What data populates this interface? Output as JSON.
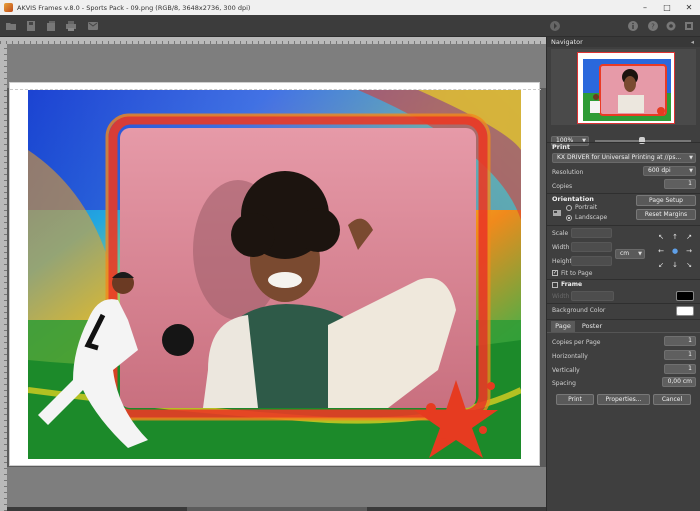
{
  "window": {
    "title": "AKVIS Frames v.8.0 - Sports Pack - 09.png (RGB/8, 3648x2736, 300 dpi)",
    "buttons": [
      "–",
      "□",
      "✕"
    ]
  },
  "toolbar": {
    "left_icons": [
      "open-icon",
      "save-icon",
      "batch-icon",
      "print-icon",
      "share-icon"
    ],
    "right_icons": [
      "run-icon",
      "info-icon",
      "help-icon",
      "settings-icon",
      "plugin-icon"
    ]
  },
  "navigator": {
    "title": "Navigator",
    "zoom": "100%",
    "zoom_slider_fraction": 0.5
  },
  "print": {
    "title": "Print",
    "printer": "KX DRIVER for Universal Printing at //ps...",
    "resolution_label": "Resolution",
    "resolution": "600 dpi",
    "copies_label": "Copies",
    "copies": "1"
  },
  "orientation": {
    "title": "Orientation",
    "portrait": "Portrait",
    "landscape": "Landscape",
    "selected": "Landscape",
    "page_setup": "Page Setup",
    "reset_margins": "Reset Margins"
  },
  "size": {
    "scale_label": "Scale",
    "width_label": "Width",
    "height_label": "Height",
    "scale": "",
    "width": "",
    "height": "",
    "unit": "cm",
    "fit_to_page_label": "Fit to Page",
    "fit_to_page": true,
    "arrows": [
      "↖",
      "↑",
      "↗",
      "←",
      "●",
      "→",
      "↙",
      "↓",
      "↘"
    ]
  },
  "frame": {
    "label": "Frame",
    "checked": false,
    "width_label": "Width",
    "width": "",
    "color": "#000000"
  },
  "background": {
    "label": "Background Color",
    "color": "#ffffff"
  },
  "tabs": [
    "Page",
    "Poster"
  ],
  "active_tab": "Page",
  "page": {
    "copies_per_page_label": "Copies per Page",
    "copies_per_page": "1",
    "horizontally_label": "Horizontally",
    "horizontally": "1",
    "vertically_label": "Vertically",
    "vertically": "1",
    "spacing_label": "Spacing",
    "spacing": "0,00 cm"
  },
  "actions": {
    "print": "Print",
    "properties": "Properties...",
    "cancel": "Cancel"
  }
}
